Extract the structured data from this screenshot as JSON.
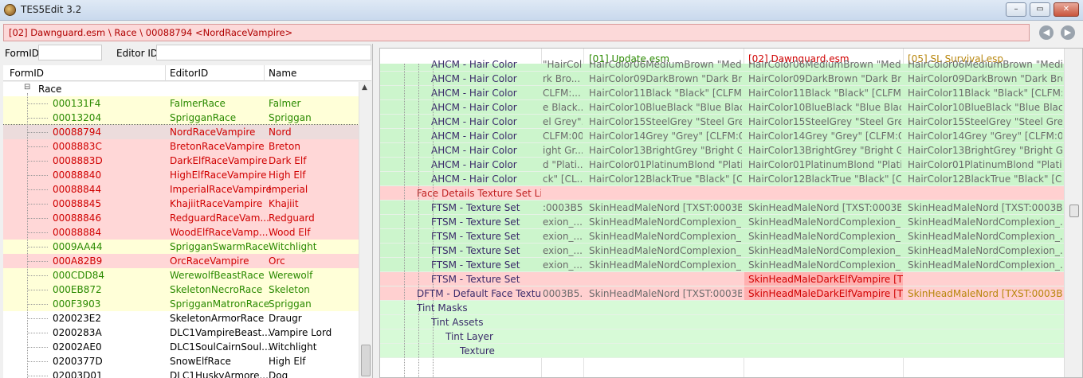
{
  "window": {
    "title": "TES5Edit 3.2",
    "controls": [
      "–",
      "▭",
      "✕"
    ]
  },
  "path_bar": {
    "text": "[02] Dawnguard.esm \\ Race \\ 00088794 <NordRaceVampire>"
  },
  "filter": {
    "formid_label": "FormID",
    "editorid_label": "Editor ID",
    "formid_value": "",
    "editorid_value": ""
  },
  "left_list": {
    "columns": [
      "FormID",
      "EditorID",
      "Name"
    ],
    "group_label": "Race",
    "rows": [
      {
        "formid": "000131F4",
        "editorid": "FalmerRace",
        "name": "Falmer",
        "bg": "yellow",
        "fg": "green"
      },
      {
        "formid": "00013204",
        "editorid": "SprigganRace",
        "name": "Spriggan",
        "bg": "yellow",
        "fg": "green"
      },
      {
        "formid": "00088794",
        "editorid": "NordRaceVampire",
        "name": "Nord",
        "bg": "sel",
        "fg": "red"
      },
      {
        "formid": "0008883C",
        "editorid": "BretonRaceVampire",
        "name": "Breton",
        "bg": "red",
        "fg": "red"
      },
      {
        "formid": "0008883D",
        "editorid": "DarkElfRaceVampire",
        "name": "Dark Elf",
        "bg": "red",
        "fg": "red"
      },
      {
        "formid": "00088840",
        "editorid": "HighElfRaceVampire",
        "name": "High Elf",
        "bg": "red",
        "fg": "red"
      },
      {
        "formid": "00088844",
        "editorid": "ImperialRaceVampire",
        "name": "Imperial",
        "bg": "red",
        "fg": "red"
      },
      {
        "formid": "00088845",
        "editorid": "KhajiitRaceVampire",
        "name": "Khajiit",
        "bg": "red",
        "fg": "red"
      },
      {
        "formid": "00088846",
        "editorid": "RedguardRaceVam...",
        "name": "Redguard",
        "bg": "red",
        "fg": "red"
      },
      {
        "formid": "00088884",
        "editorid": "WoodElfRaceVamp...",
        "name": "Wood Elf",
        "bg": "red",
        "fg": "red"
      },
      {
        "formid": "0009AA44",
        "editorid": "SprigganSwarmRace",
        "name": "Witchlight",
        "bg": "yellow",
        "fg": "green"
      },
      {
        "formid": "000A82B9",
        "editorid": "OrcRaceVampire",
        "name": "Orc",
        "bg": "red",
        "fg": "red"
      },
      {
        "formid": "000CDD84",
        "editorid": "WerewolfBeastRace",
        "name": "Werewolf",
        "bg": "yellow",
        "fg": "green"
      },
      {
        "formid": "000EB872",
        "editorid": "SkeletonNecroRace",
        "name": "Skeleton",
        "bg": "yellow",
        "fg": "green"
      },
      {
        "formid": "000F3903",
        "editorid": "SprigganMatronRace",
        "name": "Spriggan",
        "bg": "yellow",
        "fg": "green"
      },
      {
        "formid": "020023E2",
        "editorid": "SkeletonArmorRace",
        "name": "Draugr",
        "bg": "white",
        "fg": "black"
      },
      {
        "formid": "0200283A",
        "editorid": "DLC1VampireBeast...",
        "name": "Vampire Lord",
        "bg": "white",
        "fg": "black"
      },
      {
        "formid": "02002AE0",
        "editorid": "DLC1SoulCairnSoul...",
        "name": "Witchlight",
        "bg": "white",
        "fg": "black"
      },
      {
        "formid": "0200377D",
        "editorid": "SnowElfRace",
        "name": "High Elf",
        "bg": "white",
        "fg": "black"
      },
      {
        "formid": "02003D01",
        "editorid": "DLC1HuskyArmore...",
        "name": "Dog",
        "bg": "white",
        "fg": "black"
      }
    ]
  },
  "right_view": {
    "columns": [
      "",
      "[01] Update.esm",
      "[02] Dawnguard.esm",
      "[05] SL Survival.esp"
    ],
    "rows": [
      {
        "indent": 3,
        "name": "AHCM - Hair Color",
        "c0": "\"HairColor06MediumBrown \"Medi...",
        "c1": "HairColor06MediumBrown \"Medi...",
        "c2": "HairColor06MediumBrown \"Medi...",
        "c3": "HairColor06MediumBrown \"Medi...",
        "bg": "green",
        "partial": true
      },
      {
        "indent": 3,
        "name": "AHCM - Hair Color",
        "c0": "rk Bro...",
        "c1": "HairColor09DarkBrown \"Dark Bro...",
        "c2": "HairColor09DarkBrown \"Dark Bro...",
        "c3": "HairColor09DarkBrown \"Dark Bro...",
        "bg": "green"
      },
      {
        "indent": 3,
        "name": "AHCM - Hair Color",
        "c0": "CLFM:...",
        "c1": "HairColor11Black \"Black\" [CLFM:...",
        "c2": "HairColor11Black \"Black\" [CLFM:...",
        "c3": "HairColor11Black \"Black\" [CLFM:...",
        "bg": "green"
      },
      {
        "indent": 3,
        "name": "AHCM - Hair Color",
        "c0": "e Black...",
        "c1": "HairColor10BlueBlack \"Blue Black...",
        "c2": "HairColor10BlueBlack \"Blue Black...",
        "c3": "HairColor10BlueBlack \"Blue Black...",
        "bg": "green"
      },
      {
        "indent": 3,
        "name": "AHCM - Hair Color",
        "c0": "el Grey\"...",
        "c1": "HairColor15SteelGrey \"Steel Grey\"...",
        "c2": "HairColor15SteelGrey \"Steel Grey\"...",
        "c3": "HairColor15SteelGrey \"Steel Grey\"...",
        "bg": "green"
      },
      {
        "indent": 3,
        "name": "AHCM - Hair Color",
        "c0": "CLFM:00...",
        "c1": "HairColor14Grey \"Grey\" [CLFM:00...",
        "c2": "HairColor14Grey \"Grey\" [CLFM:00...",
        "c3": "HairColor14Grey \"Grey\" [CLFM:00...",
        "bg": "green"
      },
      {
        "indent": 3,
        "name": "AHCM - Hair Color",
        "c0": "ight Gr...",
        "c1": "HairColor13BrightGrey \"Bright Gr...",
        "c2": "HairColor13BrightGrey \"Bright Gr...",
        "c3": "HairColor13BrightGrey \"Bright Gr...",
        "bg": "green"
      },
      {
        "indent": 3,
        "name": "AHCM - Hair Color",
        "c0": "d \"Plati...",
        "c1": "HairColor01PlatinumBlond \"Plati...",
        "c2": "HairColor01PlatinumBlond \"Plati...",
        "c3": "HairColor01PlatinumBlond \"Plati...",
        "bg": "green"
      },
      {
        "indent": 3,
        "name": "AHCM - Hair Color",
        "c0": "ck\" [CL...",
        "c1": "HairColor12BlackTrue \"Black\" [CL...",
        "c2": "HairColor12BlackTrue \"Black\" [CL...",
        "c3": "HairColor12BlackTrue \"Black\" [CL...",
        "bg": "green"
      },
      {
        "indent": 2,
        "name": "Face Details Texture Set Lis...",
        "c0": "",
        "c1": "",
        "c2": "",
        "c3": "",
        "bg": "red",
        "nameRed": true
      },
      {
        "indent": 3,
        "name": "FTSM - Texture Set",
        "c0": ":0003B5...",
        "c1": "SkinHeadMaleNord [TXST:0003B5...",
        "c2": "SkinHeadMaleNord [TXST:0003B5...",
        "c3": "SkinHeadMaleNord [TXST:0003B5...",
        "bg": "green"
      },
      {
        "indent": 3,
        "name": "FTSM - Texture Set",
        "c0": "exion_...",
        "c1": "SkinHeadMaleNordComplexion_...",
        "c2": "SkinHeadMaleNordComplexion_...",
        "c3": "SkinHeadMaleNordComplexion_...",
        "bg": "green"
      },
      {
        "indent": 3,
        "name": "FTSM - Texture Set",
        "c0": "exion_...",
        "c1": "SkinHeadMaleNordComplexion_...",
        "c2": "SkinHeadMaleNordComplexion_...",
        "c3": "SkinHeadMaleNordComplexion_...",
        "bg": "green"
      },
      {
        "indent": 3,
        "name": "FTSM - Texture Set",
        "c0": "exion_...",
        "c1": "SkinHeadMaleNordComplexion_...",
        "c2": "SkinHeadMaleNordComplexion_...",
        "c3": "SkinHeadMaleNordComplexion_...",
        "bg": "green"
      },
      {
        "indent": 3,
        "name": "FTSM - Texture Set",
        "c0": "exion_...",
        "c1": "SkinHeadMaleNordComplexion_...",
        "c2": "SkinHeadMaleNordComplexion_...",
        "c3": "SkinHeadMaleNordComplexion_...",
        "bg": "green"
      },
      {
        "indent": 3,
        "name": "FTSM - Texture Set",
        "c0": "",
        "c1": "",
        "c2": "SkinHeadMaleDarkElfVampire [TX...",
        "c3": "",
        "bg": "red",
        "c2red": true
      },
      {
        "indent": 2,
        "name": "DFTM - Default Face Textu...",
        "c0": "0003B5...",
        "c1": "SkinHeadMaleNord [TXST:0003B5...",
        "c2": "SkinHeadMaleDarkElfVampire [TX...",
        "c3": "SkinHeadMaleNord [TXST:0003B5...",
        "bg": "red",
        "c2red": true,
        "c3orange": true
      },
      {
        "indent": 2,
        "name": "Tint Masks",
        "c0": "",
        "c1": "",
        "c2": "",
        "c3": "",
        "bg": "lgreen"
      },
      {
        "indent": 3,
        "name": "Tint Assets",
        "c0": "",
        "c1": "",
        "c2": "",
        "c3": "",
        "bg": "lgreen"
      },
      {
        "indent": 4,
        "name": "Tint Layer",
        "c0": "",
        "c1": "",
        "c2": "",
        "c3": "",
        "bg": "lgreen"
      },
      {
        "indent": 5,
        "name": "Texture",
        "c0": "",
        "c1": "",
        "c2": "",
        "c3": "",
        "bg": "lgreen"
      }
    ]
  },
  "colors": {
    "accent_red": "#d00000",
    "accent_green": "#2a8a00",
    "row_green": "#ccf5cc",
    "row_red": "#ffd0d0"
  }
}
